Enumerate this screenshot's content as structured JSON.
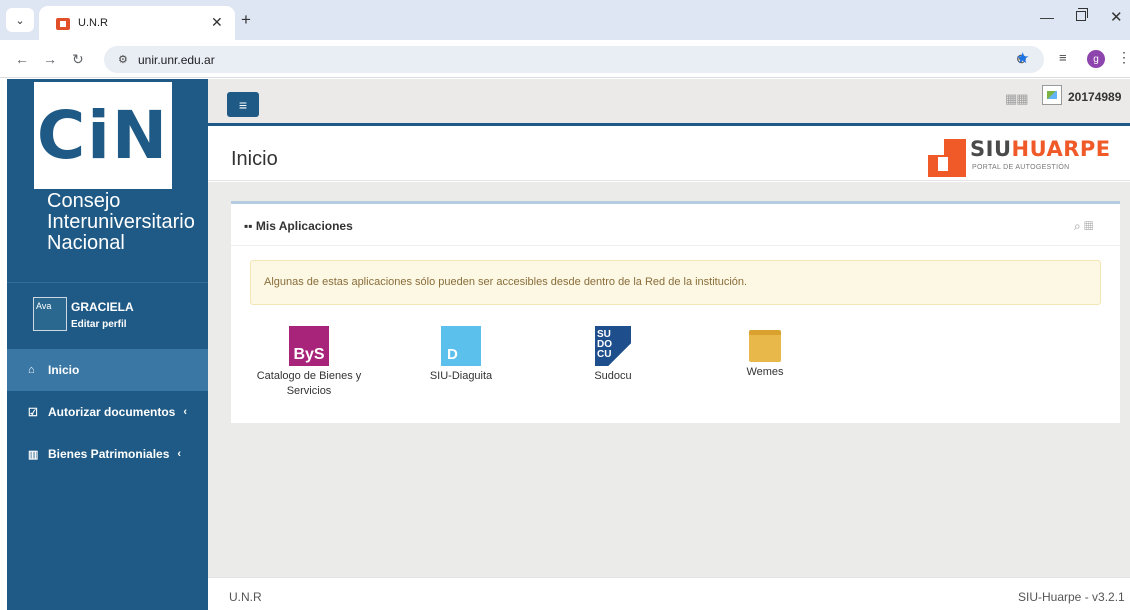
{
  "browser": {
    "tab_title": "U.N.R",
    "url": "unir.unr.edu.ar",
    "profile_initial": "g",
    "tab_menu_icon": "chevron-down-icon",
    "close_tab_icon": "close-icon",
    "new_tab_icon": "plus-icon"
  },
  "sidebar": {
    "logo_text": "CiN",
    "org_name": "Consejo Interuniversitario Nacional",
    "avatar_alt": "Ava",
    "user_name": "GRACIELA",
    "edit_profile": "Editar perfil",
    "items": [
      {
        "label": "Inicio",
        "icon": "home-icon",
        "active": true,
        "has_chevron": false
      },
      {
        "label": "Autorizar documentos",
        "icon": "check-square-icon",
        "active": false,
        "has_chevron": true
      },
      {
        "label": "Bienes Patrimoniales",
        "icon": "barcode-icon",
        "active": false,
        "has_chevron": true
      }
    ]
  },
  "topbar": {
    "user_id": "20174989"
  },
  "header": {
    "page_title": "Inicio",
    "brand_siu": "SIU",
    "brand_huarpe": "HUARPE",
    "brand_sub": "PORTAL DE AUTOGESTIÓN"
  },
  "panel": {
    "title": "Mis Aplicaciones",
    "alert": "Algunas de estas aplicaciones sólo pueden ser accesibles desde dentro de la Red de la institución.",
    "apps": [
      {
        "label": "Catalogo de Bienes y Servicios",
        "icon_text": "ByS",
        "icon": "bys-icon",
        "color": "#a8237a"
      },
      {
        "label": "SIU-Diaguita",
        "icon_text": "D",
        "icon": "diaguita-icon",
        "color": "#5bc0eb"
      },
      {
        "label": "Sudocu",
        "icon_text": "SU DO CU",
        "icon": "sudocu-icon",
        "color": "#1f4e8c"
      },
      {
        "label": "Wemes",
        "icon_text": "",
        "icon": "folder-icon",
        "color": "#e8b84a"
      }
    ]
  },
  "footer": {
    "left": "U.N.R",
    "right": "SIU-Huarpe - v3.2.1"
  },
  "colors": {
    "sidebar": "#1e5a85",
    "sidebar_active": "#3a77a5",
    "accent": "#f05a28",
    "alert_bg": "#fcf8e3"
  }
}
